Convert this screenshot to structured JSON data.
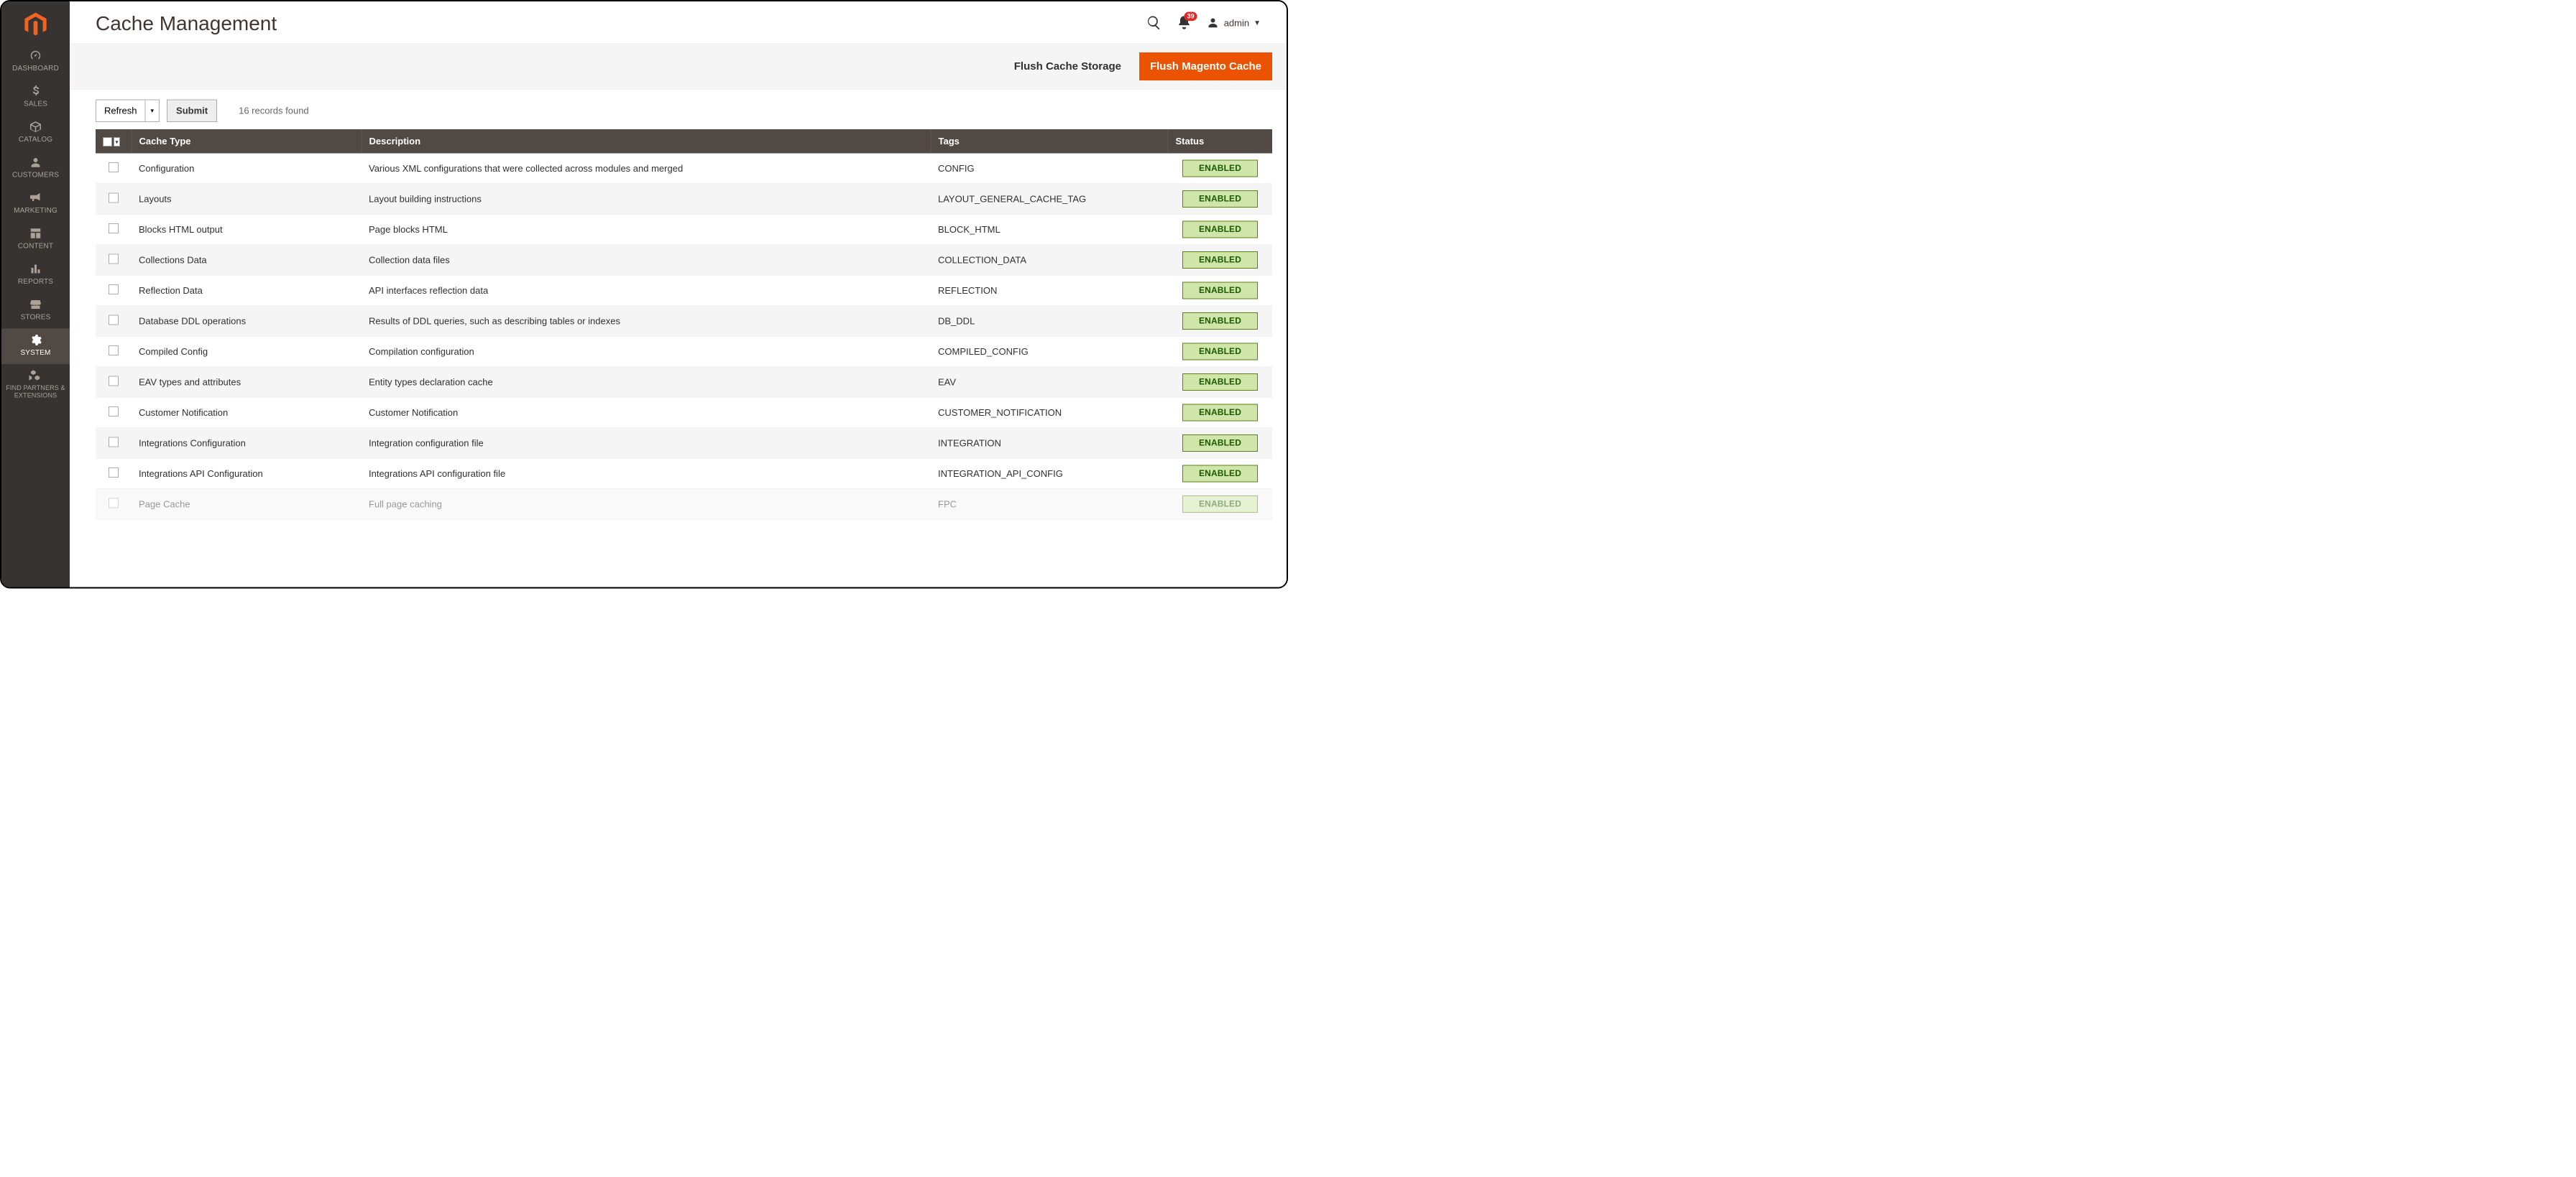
{
  "sidebar": {
    "items": [
      {
        "id": "dashboard",
        "label": "DASHBOARD",
        "icon": "gauge"
      },
      {
        "id": "sales",
        "label": "SALES",
        "icon": "dollar"
      },
      {
        "id": "catalog",
        "label": "CATALOG",
        "icon": "box"
      },
      {
        "id": "customers",
        "label": "CUSTOMERS",
        "icon": "person"
      },
      {
        "id": "marketing",
        "label": "MARKETING",
        "icon": "bullhorn"
      },
      {
        "id": "content",
        "label": "CONTENT",
        "icon": "layout"
      },
      {
        "id": "reports",
        "label": "REPORTS",
        "icon": "bars"
      },
      {
        "id": "stores",
        "label": "STORES",
        "icon": "storefront"
      },
      {
        "id": "system",
        "label": "SYSTEM",
        "icon": "gear",
        "active": true
      },
      {
        "id": "partners",
        "label": "FIND PARTNERS & EXTENSIONS",
        "icon": "boxes"
      }
    ]
  },
  "header": {
    "title": "Cache Management",
    "notifications_count": "39",
    "user_name": "admin"
  },
  "action_bar": {
    "flush_storage": "Flush Cache Storage",
    "flush_magento": "Flush Magento Cache"
  },
  "toolbar": {
    "mass_action": "Refresh",
    "submit": "Submit",
    "records_found": "16 records found"
  },
  "table": {
    "columns": {
      "cache_type": "Cache Type",
      "description": "Description",
      "tags": "Tags",
      "status": "Status"
    },
    "rows": [
      {
        "type": "Configuration",
        "desc": "Various XML configurations that were collected across modules and merged",
        "tags": "CONFIG",
        "status": "ENABLED"
      },
      {
        "type": "Layouts",
        "desc": "Layout building instructions",
        "tags": "LAYOUT_GENERAL_CACHE_TAG",
        "status": "ENABLED"
      },
      {
        "type": "Blocks HTML output",
        "desc": "Page blocks HTML",
        "tags": "BLOCK_HTML",
        "status": "ENABLED"
      },
      {
        "type": "Collections Data",
        "desc": "Collection data files",
        "tags": "COLLECTION_DATA",
        "status": "ENABLED"
      },
      {
        "type": "Reflection Data",
        "desc": "API interfaces reflection data",
        "tags": "REFLECTION",
        "status": "ENABLED"
      },
      {
        "type": "Database DDL operations",
        "desc": "Results of DDL queries, such as describing tables or indexes",
        "tags": "DB_DDL",
        "status": "ENABLED"
      },
      {
        "type": "Compiled Config",
        "desc": "Compilation configuration",
        "tags": "COMPILED_CONFIG",
        "status": "ENABLED"
      },
      {
        "type": "EAV types and attributes",
        "desc": "Entity types declaration cache",
        "tags": "EAV",
        "status": "ENABLED"
      },
      {
        "type": "Customer Notification",
        "desc": "Customer Notification",
        "tags": "CUSTOMER_NOTIFICATION",
        "status": "ENABLED"
      },
      {
        "type": "Integrations Configuration",
        "desc": "Integration configuration file",
        "tags": "INTEGRATION",
        "status": "ENABLED"
      },
      {
        "type": "Integrations API Configuration",
        "desc": "Integrations API configuration file",
        "tags": "INTEGRATION_API_CONFIG",
        "status": "ENABLED"
      },
      {
        "type": "Page Cache",
        "desc": "Full page caching",
        "tags": "FPC",
        "status": "ENABLED"
      }
    ]
  },
  "colors": {
    "accent": "#eb5202",
    "sidebar_bg": "#363330",
    "header_bg": "#514943",
    "status_enabled_bg": "#d0e5a9",
    "status_enabled_border": "#5b8116"
  }
}
